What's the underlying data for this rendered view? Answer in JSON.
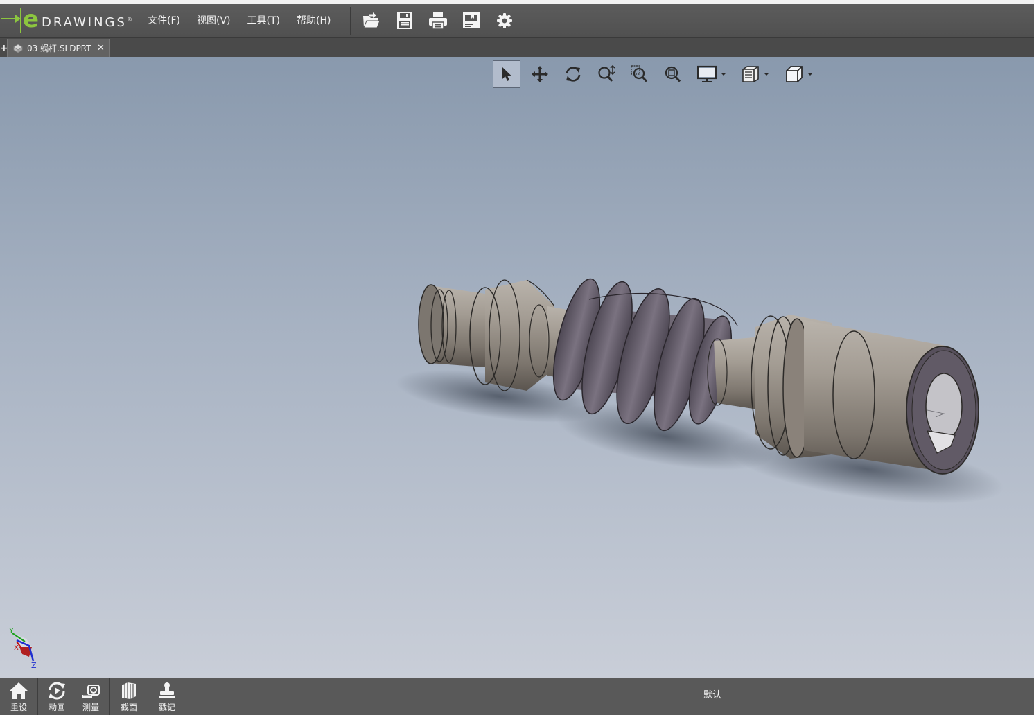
{
  "app": {
    "logo_text": "DRAWINGS",
    "logo_e": "e",
    "logo_registered": "®"
  },
  "menu": [
    {
      "label": "文件(F)"
    },
    {
      "label": "视图(V)"
    },
    {
      "label": "工具(T)"
    },
    {
      "label": "帮助(H)"
    }
  ],
  "file_tools": [
    "open-icon",
    "save-icon",
    "print-icon",
    "markup-icon",
    "settings-icon"
  ],
  "tab": {
    "title": "03 蜗杆.SLDPRT",
    "close": "✕",
    "add": "+"
  },
  "view_tools": [
    "select-icon",
    "pan-icon",
    "rotate-icon",
    "zoom-icon",
    "zoom-to-area-icon",
    "zoom-to-fit-icon",
    "display-style-icon",
    "sheet-view-icon",
    "standard-views-icon"
  ],
  "triad": {
    "y": "Y",
    "x": "X",
    "z": "Z"
  },
  "bottom_tools": [
    {
      "label": "重设",
      "icon": "home-icon"
    },
    {
      "label": "动画",
      "icon": "animate-icon"
    },
    {
      "label": "测量",
      "icon": "measure-icon"
    },
    {
      "label": "截面",
      "icon": "section-icon"
    },
    {
      "label": "戳记",
      "icon": "stamp-icon"
    }
  ],
  "configuration": "默认",
  "colors": {
    "accent_green": "#8cc63f",
    "toolbar": "#565656",
    "viewport_top": "#8999ad",
    "viewport_bottom": "#c9ced8",
    "part_body": "#8e877f"
  }
}
